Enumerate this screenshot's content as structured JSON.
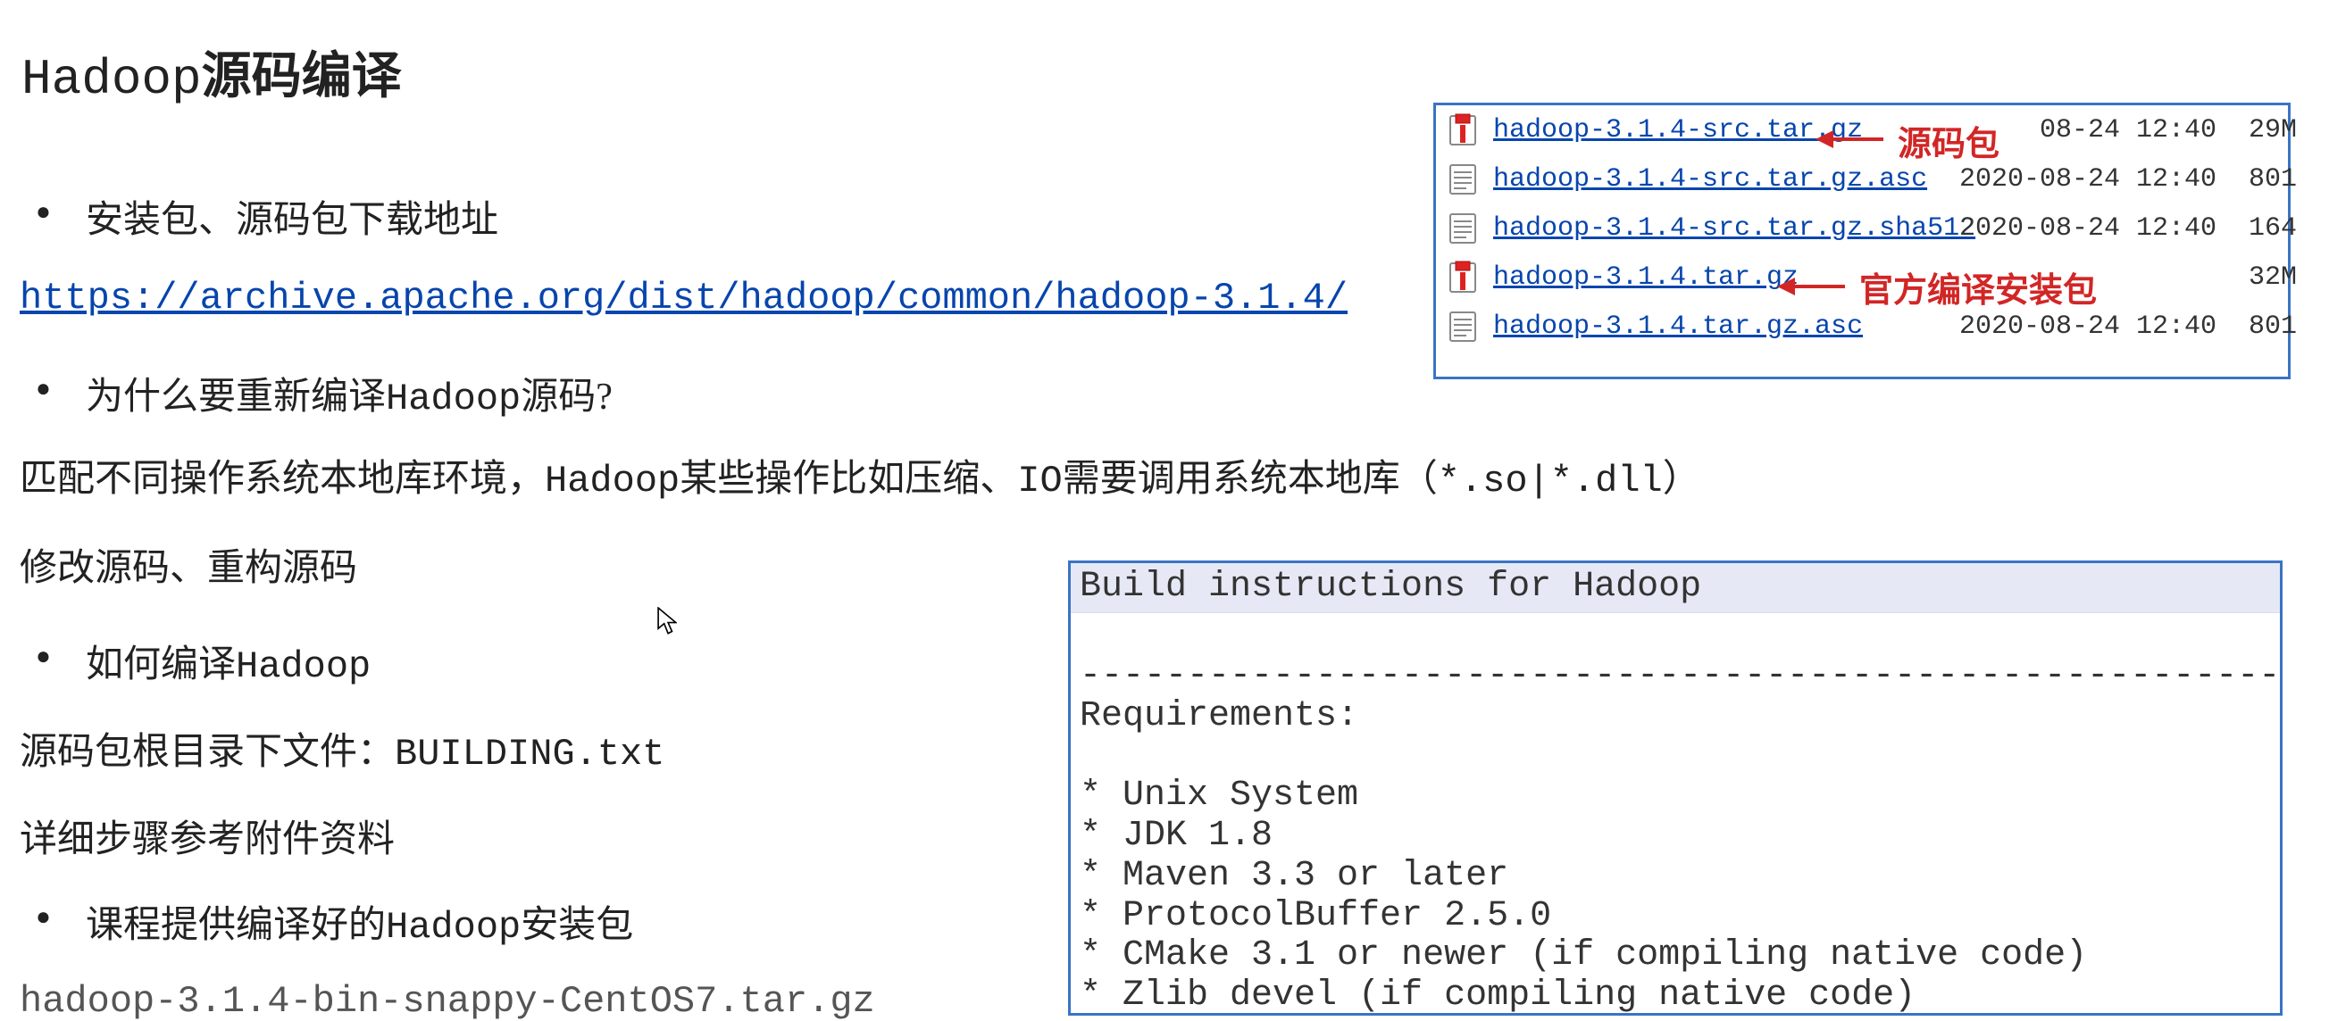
{
  "title": {
    "mono": "Hadoop",
    "bold": "源码编译"
  },
  "bullets": {
    "b1": "安装包、源码包下载地址",
    "b2_prefix": "为什么要重新编译",
    "b2_mono": "Hadoop",
    "b2_suffix": "源码?",
    "b3_prefix": "如何编译",
    "b3_mono": "Hadoop",
    "b4_prefix": "课程提供编译好的",
    "b4_mono": "Hadoop",
    "b4_suffix": "安装包"
  },
  "main_link": "https://archive.apache.org/dist/hadoop/common/hadoop-3.1.4/",
  "paras": {
    "p1_a": "匹配不同操作系统本地库环境，",
    "p1_mono": "Hadoop",
    "p1_b": "某些操作比如压缩、",
    "p1_c_mono": "IO",
    "p1_d": "需要调用系统本地库（",
    "p1_e_mono": "*.so|*.dll",
    "p1_f": "）",
    "p2": "修改源码、重构源码",
    "p3_a": "源码包根目录下文件：",
    "p3_mono": "BUILDING.txt",
    "p4": "详细步骤参考附件资料",
    "p5": "hadoop-3.1.4-bin-snappy-CentOS7.tar.gz"
  },
  "file_listing": {
    "rows": [
      {
        "icon": "archive",
        "name": "hadoop-3.1.4-src.tar.gz",
        "date": "08-24 12:40",
        "size": "29M"
      },
      {
        "icon": "text",
        "name": "hadoop-3.1.4-src.tar.gz.asc",
        "date": "2020-08-24 12:40",
        "size": "801"
      },
      {
        "icon": "text",
        "name": "hadoop-3.1.4-src.tar.gz.sha512",
        "date": "2020-08-24 12:40",
        "size": "164"
      },
      {
        "icon": "archive",
        "name": "hadoop-3.1.4.tar.gz",
        "date": "",
        "size": "32M"
      },
      {
        "icon": "text",
        "name": "hadoop-3.1.4.tar.gz.asc",
        "date": "2020-08-24 12:40",
        "size": "801"
      }
    ]
  },
  "annotations": {
    "src_label": "源码包",
    "bin_label": "官方编译安装包"
  },
  "build_box": {
    "header": "Build instructions for Hadoop",
    "body": "\n----------------------------------------------------------\nRequirements:\n\n* Unix System\n* JDK 1.8\n* Maven 3.3 or later\n* ProtocolBuffer 2.5.0\n* CMake 3.1 or newer (if compiling native code)\n* Zlib devel (if compiling native code)"
  }
}
